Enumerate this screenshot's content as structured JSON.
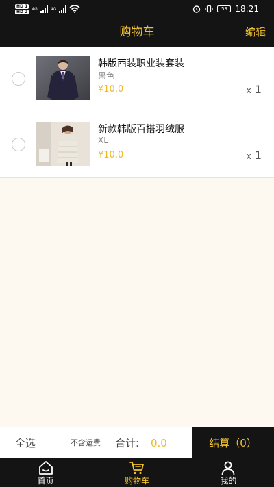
{
  "status_bar": {
    "hd1": "HD 1",
    "hd2": "HD 2",
    "net1": "4G",
    "net2": "4G",
    "battery": "53",
    "time": "18:21"
  },
  "header": {
    "title": "购物车",
    "edit_label": "编辑"
  },
  "cart": {
    "items": [
      {
        "name": "韩版西装职业装套装",
        "spec": "黑色",
        "price": "¥10.0",
        "qty_prefix": "x",
        "qty": "1",
        "image_icon": "suit-photo"
      },
      {
        "name": "新款韩版百搭羽绒服",
        "spec": "XL",
        "price": "¥10.0",
        "qty_prefix": "x",
        "qty": "1",
        "image_icon": "down-jacket-photo"
      }
    ]
  },
  "bottom_bar": {
    "select_all": "全选",
    "shipping_note": "不含运费",
    "total_label": "合计:",
    "total_value": "0.0",
    "checkout": "结算（0）"
  },
  "tabbar": {
    "tabs": [
      {
        "label": "首页",
        "icon": "home-icon",
        "active": false
      },
      {
        "label": "购物车",
        "icon": "cart-icon",
        "active": true
      },
      {
        "label": "我的",
        "icon": "profile-icon",
        "active": false
      }
    ]
  },
  "colors": {
    "accent": "#f2c230",
    "bar": "#141414",
    "background": "#fdf8f0",
    "price": "#f0b820"
  }
}
